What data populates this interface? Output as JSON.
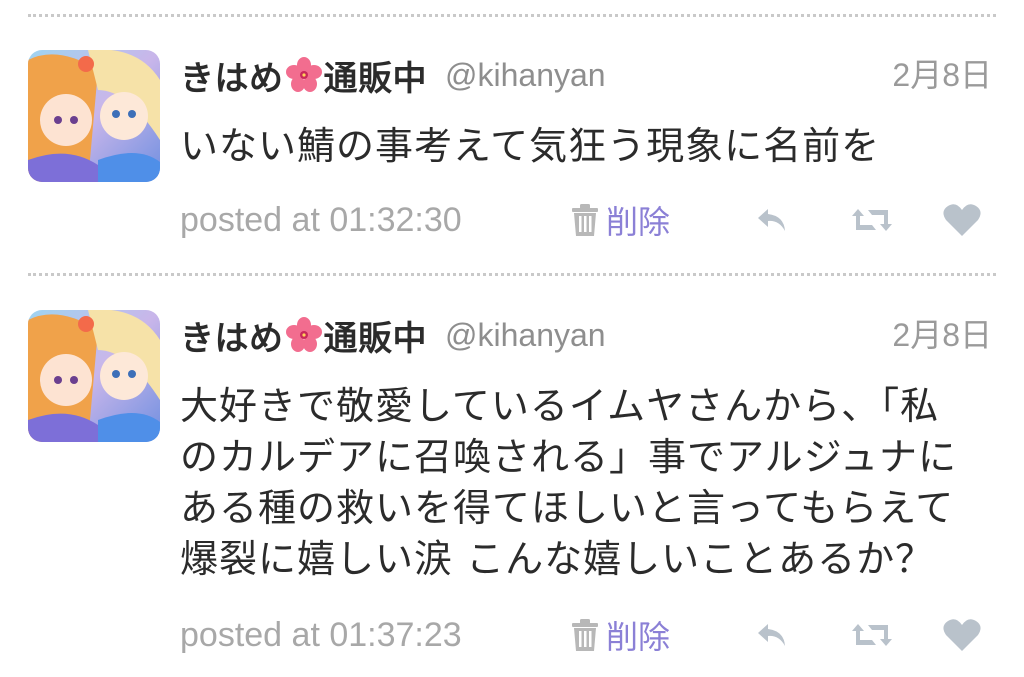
{
  "tweets": [
    {
      "display_name_part1": "きはめ",
      "display_name_part2": "通販中",
      "handle": "@kihanyan",
      "date": "2月8日",
      "lines": [
        "いない鯖の事考えて気狂う現象に名前を"
      ],
      "posted_at": "posted at 01:32:30",
      "delete_label": "削除"
    },
    {
      "display_name_part1": "きはめ",
      "display_name_part2": "通販中",
      "handle": "@kihanyan",
      "date": "2月8日",
      "lines": [
        "大好きで敬愛しているイムヤさんから、「私",
        "のカルデアに召喚される」事でアルジュナに",
        "ある種の救いを得てほしいと言ってもらえて",
        "爆裂に嬉しい涙 こんな嬉しいことあるか？"
      ],
      "posted_at": "posted at 01:37:23",
      "delete_label": "削除"
    }
  ],
  "icons": {
    "name_emoji": "hibiscus-flower-icon",
    "delete": "trash-icon",
    "reply": "reply-arrow-icon",
    "retweet": "retweet-icon",
    "like": "heart-icon"
  },
  "colors": {
    "delete_accent": "#8b80d6",
    "meta_gray": "#a8a8a8",
    "icon_gray": "#b9c2cb"
  }
}
